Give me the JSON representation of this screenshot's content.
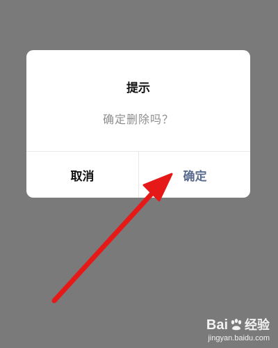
{
  "dialog": {
    "title": "提示",
    "message": "确定删除吗？",
    "cancel_label": "取消",
    "confirm_label": "确定"
  },
  "colors": {
    "overlay": "#7a7a7a",
    "dialog_bg": "#ffffff",
    "confirm_text": "#5a6b90",
    "message_text": "#8e8e8e",
    "arrow": "#e61919"
  },
  "watermark": {
    "brand_left": "Bai",
    "brand_right": "经验",
    "url": "jingyan.baidu.com"
  }
}
